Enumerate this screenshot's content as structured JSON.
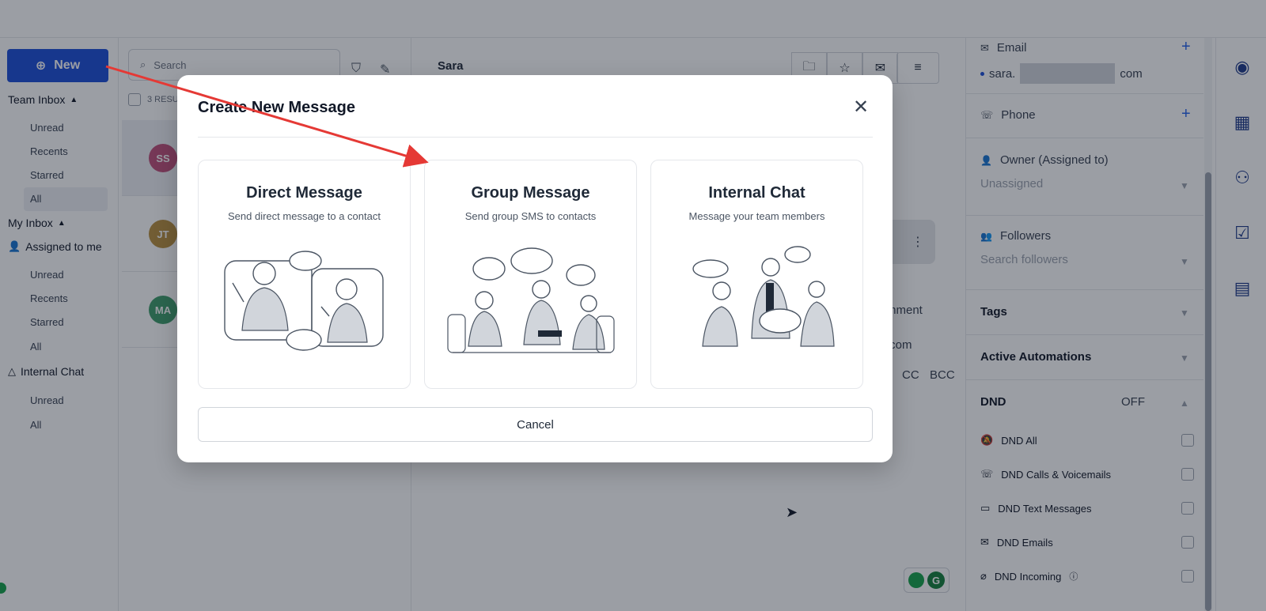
{
  "nav": {
    "new_label": "New",
    "team_inbox": "Team Inbox",
    "team_items": [
      "Unread",
      "Recents",
      "Starred",
      "All"
    ],
    "my_inbox": "My Inbox",
    "assigned_to_me": "Assigned to me",
    "my_items": [
      "Unread",
      "Recents",
      "Starred",
      "All"
    ],
    "internal_chat": "Internal Chat",
    "internal_items": [
      "Unread",
      "All"
    ]
  },
  "conversations": {
    "search_placeholder": "Search",
    "results_label": "3 RESULTS",
    "avatars": [
      {
        "initials": "SS",
        "color": "#c0507a"
      },
      {
        "initials": "JT",
        "color": "#b8903f"
      },
      {
        "initials": "MA",
        "color": "#3f9e6b"
      }
    ]
  },
  "main": {
    "contact_name": "Sara",
    "comment_label": "mment",
    "email_suffix": ".com",
    "cc": "CC",
    "bcc": "BCC"
  },
  "contact": {
    "email_label": "Email",
    "email_value_start": "sara.",
    "email_value_end": "com",
    "phone_label": "Phone",
    "owner_label": "Owner (Assigned to)",
    "owner_value": "Unassigned",
    "followers_label": "Followers",
    "followers_placeholder": "Search followers",
    "tags_label": "Tags",
    "automations_label": "Active Automations",
    "dnd_label": "DND",
    "dnd_status": "OFF",
    "dnd_items": [
      "DND All",
      "DND Calls & Voicemails",
      "DND Text Messages",
      "DND Emails",
      "DND Incoming"
    ]
  },
  "modal": {
    "title": "Create New Message",
    "cards": [
      {
        "title": "Direct Message",
        "subtitle": "Send direct message to a contact"
      },
      {
        "title": "Group Message",
        "subtitle": "Send group SMS to contacts"
      },
      {
        "title": "Internal Chat",
        "subtitle": "Message your team members"
      }
    ],
    "cancel_label": "Cancel"
  },
  "colors": {
    "primary": "#1d4ed8",
    "annotation_arrow": "#e53935"
  }
}
